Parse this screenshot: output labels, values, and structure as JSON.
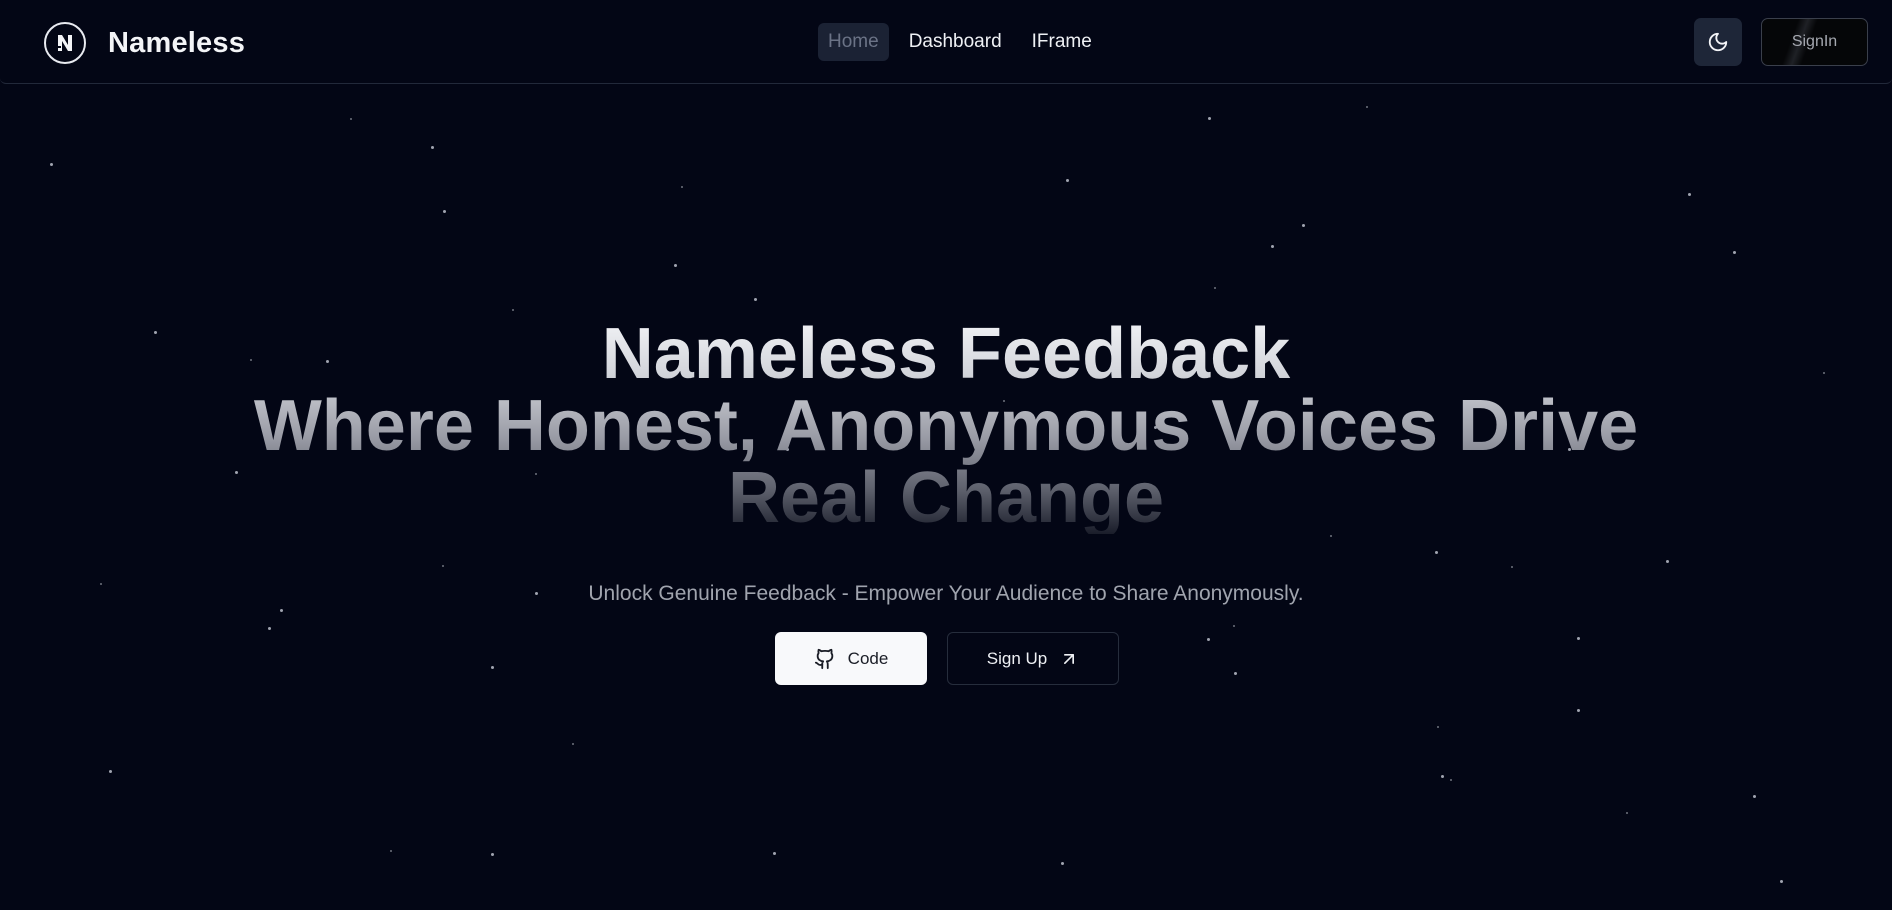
{
  "brand": {
    "name": "Nameless",
    "logo_letter": "N"
  },
  "nav": {
    "links": [
      {
        "label": "Home",
        "active": true
      },
      {
        "label": "Dashboard",
        "active": false
      },
      {
        "label": "IFrame",
        "active": false
      }
    ],
    "theme_icon": "moon-icon",
    "signin_label": "SignIn"
  },
  "hero": {
    "title_line1": "Nameless Feedback",
    "title_line2": "Where Honest, Anonymous Voices Drive",
    "title_line3": "Real Change",
    "subtitle": "Unlock Genuine Feedback - Empower Your Audience to Share Anonymously.",
    "code_button": {
      "label": "Code",
      "icon": "github-icon"
    },
    "signup_button": {
      "label": "Sign Up",
      "icon": "arrow-up-right-icon"
    }
  },
  "colors": {
    "background": "#030615",
    "nav_active_bg": "#1b2234",
    "primary_button_bg": "#f8f9fb",
    "subtitle_text": "#a0a4ae"
  }
}
